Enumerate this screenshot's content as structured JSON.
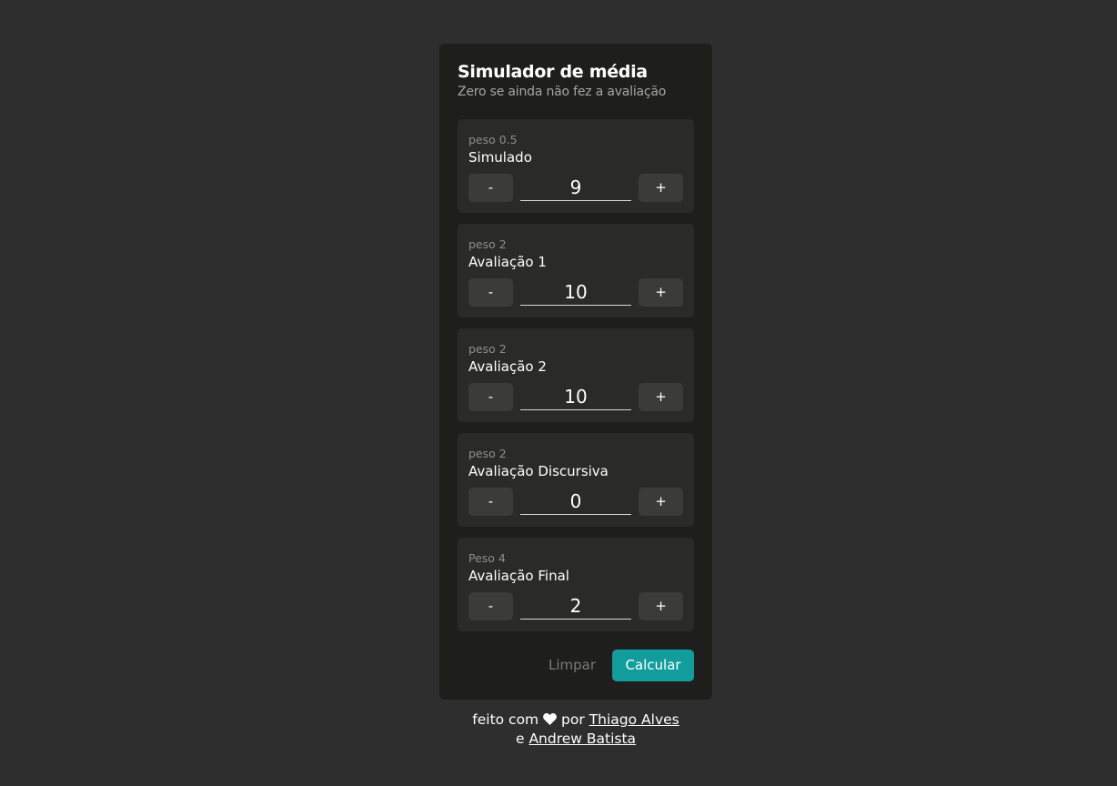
{
  "header": {
    "title": "Simulador de média",
    "subtitle": "Zero se ainda não fez a avaliação"
  },
  "grades": [
    {
      "weight": "peso 0.5",
      "name": "Simulado",
      "value": "9",
      "minus": "-",
      "plus": "+"
    },
    {
      "weight": "peso 2",
      "name": "Avaliação 1",
      "value": "10",
      "minus": "-",
      "plus": "+"
    },
    {
      "weight": "peso 2",
      "name": "Avaliação 2",
      "value": "10",
      "minus": "-",
      "plus": "+"
    },
    {
      "weight": "peso 2",
      "name": "Avaliação Discursiva",
      "value": "0",
      "minus": "-",
      "plus": "+"
    },
    {
      "weight": "Peso 4",
      "name": "Avaliação Final",
      "value": "2",
      "minus": "-",
      "plus": "+"
    }
  ],
  "actions": {
    "clear_label": "Limpar",
    "calculate_label": "Calcular"
  },
  "footer": {
    "prefix": "feito com",
    "icon": "heart-icon",
    "by": "por",
    "author1": "Thiago Alves",
    "connector": "e",
    "author2": "Andrew Batista"
  },
  "colors": {
    "accent": "#139c9c",
    "background": "#2e2e2e",
    "card": "#1e1e1c"
  }
}
